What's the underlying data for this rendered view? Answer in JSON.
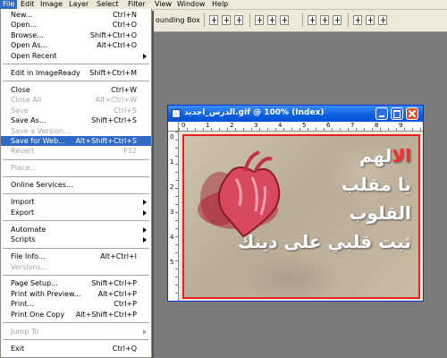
{
  "menubar": {
    "items": [
      {
        "label": "File",
        "active": true
      },
      {
        "label": "Edit"
      },
      {
        "label": "Image"
      },
      {
        "label": "Layer"
      },
      {
        "label": "Select"
      },
      {
        "label": "Filter"
      },
      {
        "label": "View"
      },
      {
        "label": "Window"
      },
      {
        "label": "Help"
      }
    ]
  },
  "options_bar": {
    "bounding_box_label": "ounding Box",
    "align_icons": [
      "align-top-icon",
      "align-vcenter-icon",
      "align-bottom-icon",
      "align-left-icon",
      "align-hcenter-icon",
      "align-right-icon"
    ],
    "distribute_icons": [
      "distribute-top-icon",
      "distribute-vcenter-icon",
      "distribute-bottom-icon",
      "distribute-left-icon",
      "distribute-hcenter-icon",
      "distribute-right-icon"
    ]
  },
  "file_menu": {
    "items": [
      {
        "label": "New...",
        "shortcut": "Ctrl+N"
      },
      {
        "label": "Open...",
        "shortcut": "Ctrl+O"
      },
      {
        "label": "Browse...",
        "shortcut": "Shift+Ctrl+O"
      },
      {
        "label": "Open As...",
        "shortcut": "Alt+Ctrl+O"
      },
      {
        "label": "Open Recent",
        "shortcut": "",
        "submenu": true
      },
      {
        "separator": true
      },
      {
        "label": "Edit in ImageReady",
        "shortcut": "Shift+Ctrl+M"
      },
      {
        "separator": true
      },
      {
        "label": "Close",
        "shortcut": "Ctrl+W"
      },
      {
        "label": "Close All",
        "shortcut": "Alt+Ctrl+W",
        "disabled": true
      },
      {
        "label": "Save",
        "shortcut": "Ctrl+S",
        "disabled": true
      },
      {
        "label": "Save As...",
        "shortcut": "Shift+Ctrl+S"
      },
      {
        "label": "Save a Version...",
        "shortcut": "",
        "disabled": true
      },
      {
        "label": "Save for Web...",
        "shortcut": "Alt+Shift+Ctrl+S",
        "highlight": true
      },
      {
        "label": "Revert",
        "shortcut": "F12",
        "disabled": true
      },
      {
        "separator": true
      },
      {
        "label": "Place...",
        "shortcut": "",
        "disabled": true
      },
      {
        "separator": true
      },
      {
        "label": "Online Services...",
        "shortcut": ""
      },
      {
        "separator": true
      },
      {
        "label": "Import",
        "shortcut": "",
        "submenu": true
      },
      {
        "label": "Export",
        "shortcut": "",
        "submenu": true
      },
      {
        "separator": true
      },
      {
        "label": "Automate",
        "shortcut": "",
        "submenu": true
      },
      {
        "label": "Scripts",
        "shortcut": "",
        "submenu": true
      },
      {
        "separator": true
      },
      {
        "label": "File Info...",
        "shortcut": "Alt+Ctrl+I"
      },
      {
        "label": "Versions...",
        "shortcut": "",
        "disabled": true
      },
      {
        "separator": true
      },
      {
        "label": "Page Setup...",
        "shortcut": "Shift+Ctrl+P"
      },
      {
        "label": "Print with Preview...",
        "shortcut": "Alt+Ctrl+P"
      },
      {
        "label": "Print...",
        "shortcut": "Ctrl+P"
      },
      {
        "label": "Print One Copy",
        "shortcut": "Alt+Shift+Ctrl+P"
      },
      {
        "separator": true
      },
      {
        "label": "Jump To",
        "shortcut": "",
        "submenu": true,
        "disabled": true
      },
      {
        "separator": true
      },
      {
        "label": "Exit",
        "shortcut": "Ctrl+Q"
      }
    ]
  },
  "document": {
    "title": "الدرس_اجديد.gif @ 100% (Index)",
    "ruler_top_numbers": [
      "0",
      "1",
      "2",
      "3",
      "4",
      "5",
      "6",
      "7",
      "8",
      "9"
    ],
    "ruler_left_numbers": [
      "0",
      "1",
      "2",
      "3",
      "4",
      "5"
    ],
    "canvas_text": {
      "line1_red": "الا",
      "line1_white": "لهم",
      "line2": "يا مقلب",
      "line3": "القلوب",
      "line4": "ثبت قلبي على دينك"
    }
  },
  "colors": {
    "menu_highlight": "#316ac5",
    "canvas_border": "#e82020",
    "titlebar": "#0a5fe0",
    "arabic_red": "#ff2a2a"
  }
}
